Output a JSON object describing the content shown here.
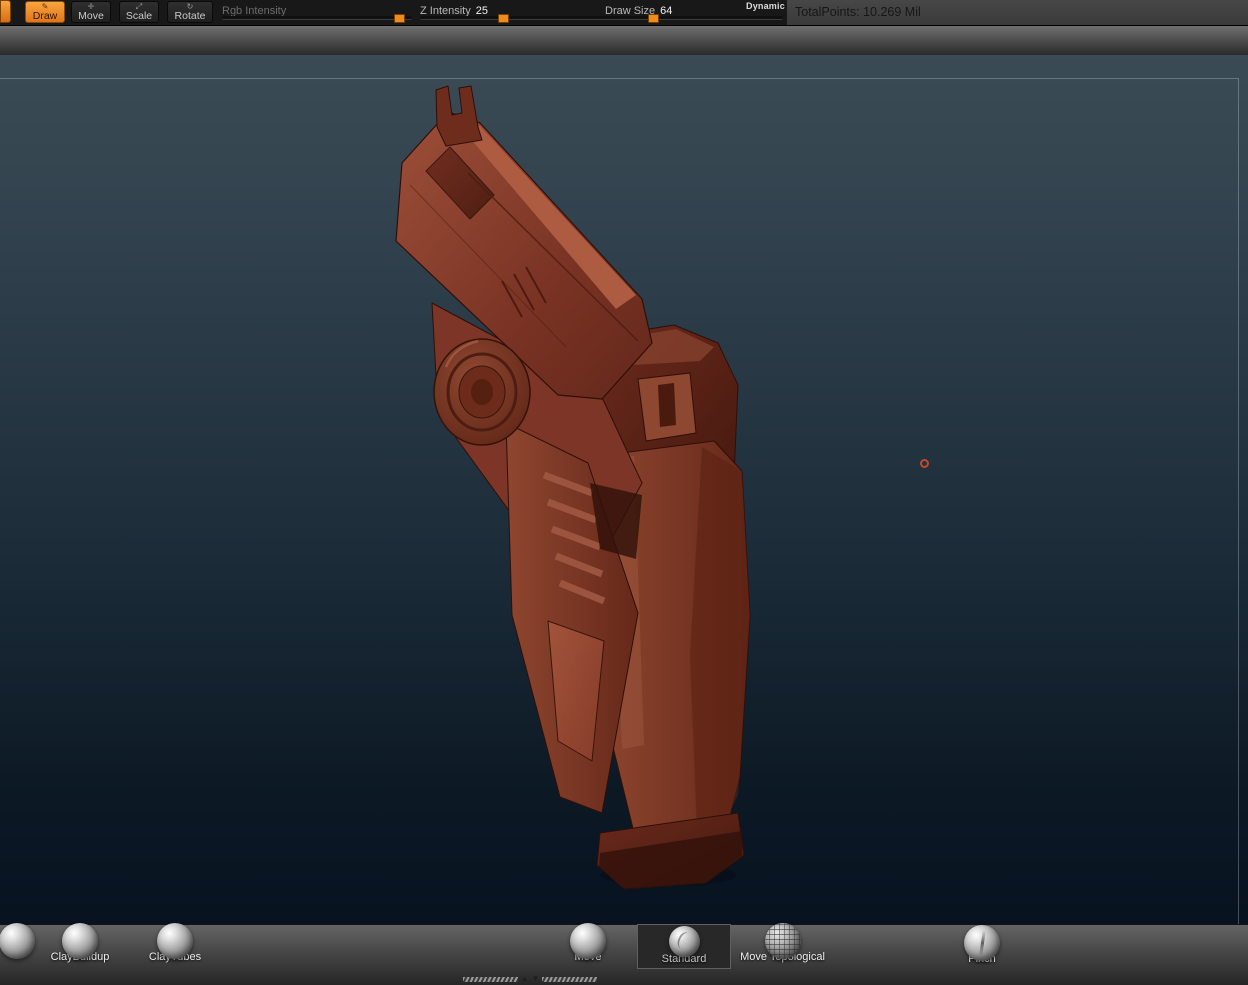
{
  "topbar": {
    "tools": [
      {
        "label": "Draw",
        "icon": "✎",
        "active": true
      },
      {
        "label": "Move",
        "icon": "✛",
        "active": false
      },
      {
        "label": "Scale",
        "icon": "⤢",
        "active": false
      },
      {
        "label": "Rotate",
        "icon": "↻",
        "active": false
      }
    ],
    "sliders": {
      "rgb_intensity": {
        "label": "Rgb Intensity",
        "value": "",
        "disabled": true
      },
      "z_intensity": {
        "label": "Z Intensity",
        "value": "25"
      },
      "draw_size": {
        "label": "Draw Size",
        "value": "64"
      }
    },
    "dynamic_label": "Dynamic",
    "total_points": "TotalPoints: 10.269 Mil"
  },
  "canvas": {
    "content_description": "red clay sculpted sci-fi pistol, 3/4 view, muzzle up-left, grip down-right"
  },
  "brush_tray": {
    "brushes": [
      {
        "label": "ClayBuildup",
        "selected": false
      },
      {
        "label": "ClayTubes",
        "selected": false
      },
      {
        "label": "Move",
        "selected": false
      },
      {
        "label": "Standard",
        "selected": true
      },
      {
        "label": "Move Topological",
        "selected": false
      },
      {
        "label": "Pinch",
        "selected": false
      }
    ],
    "icons": {
      "collapse_up": "▲",
      "collapse_down": "▼"
    }
  },
  "colors": {
    "accent_orange": "#ef8b1d",
    "clay_red": "#8a3a2a",
    "canvas_top": "#3b4b55",
    "canvas_bottom": "#081220"
  }
}
